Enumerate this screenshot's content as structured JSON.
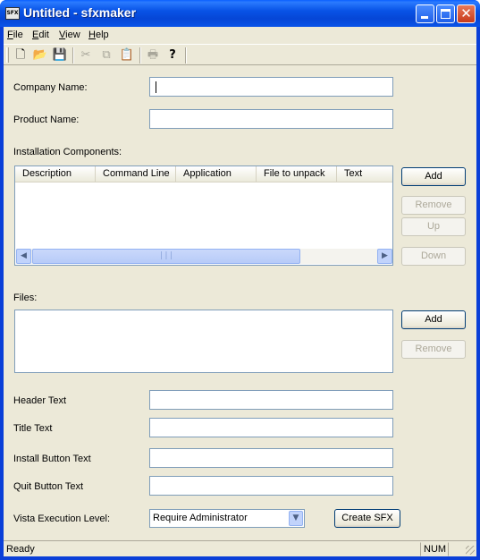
{
  "window": {
    "title": "Untitled - sfxmaker",
    "app_icon_text": "SFX"
  },
  "menu": {
    "items": [
      {
        "accel": "F",
        "rest": "ile"
      },
      {
        "accel": "E",
        "rest": "dit"
      },
      {
        "accel": "V",
        "rest": "iew"
      },
      {
        "accel": "H",
        "rest": "elp"
      }
    ]
  },
  "toolbar": {
    "icons": [
      "new-file-icon",
      "open-folder-icon",
      "save-icon",
      "cut-icon",
      "copy-icon",
      "paste-icon",
      "print-icon",
      "context-help-icon"
    ],
    "glyphs": {
      "new": "🗋",
      "open": "📂",
      "save": "💾",
      "cut": "✂",
      "copy": "⧉",
      "paste": "📋",
      "print": "🖶",
      "help": "?"
    }
  },
  "form": {
    "company_label": "Company Name:",
    "company_value": "",
    "product_label": "Product Name:",
    "product_value": "",
    "components_label": "Installation Components:",
    "components_columns": [
      "Description",
      "Command Line",
      "Application",
      "File to unpack",
      "Text"
    ],
    "components_scroll_grip": "|||",
    "files_label": "Files:",
    "header_label": "Header Text",
    "title_label": "Title Text",
    "install_label": "Install Button Text",
    "quit_label": "Quit Button Text",
    "vista_label": "Vista Execution Level:",
    "vista_value": "Require Administrator"
  },
  "buttons": {
    "add": "Add",
    "remove": "Remove",
    "up": "Up",
    "down": "Down",
    "files_add": "Add",
    "files_remove": "Remove",
    "create": "Create SFX"
  },
  "status": {
    "text": "Ready",
    "num": "NUM"
  },
  "colors": {
    "titlebar": "#0a53e8",
    "face": "#ece9d8",
    "field_border": "#7f9db9"
  }
}
